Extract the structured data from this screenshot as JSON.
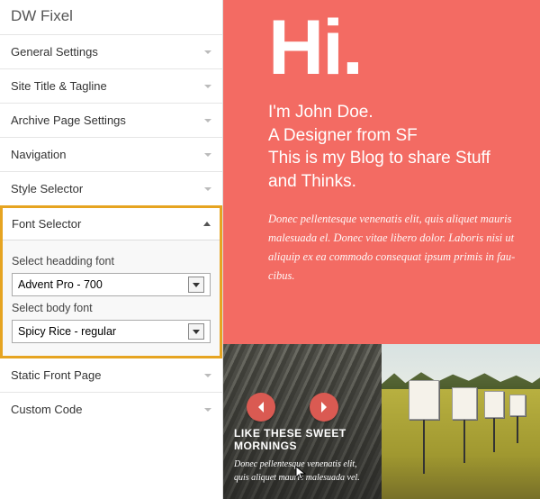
{
  "sidebar": {
    "title": "DW Fixel",
    "items": [
      {
        "label": "General Settings"
      },
      {
        "label": "Site Title & Tagline"
      },
      {
        "label": "Archive Page Settings"
      },
      {
        "label": "Navigation"
      },
      {
        "label": "Style Selector"
      }
    ],
    "font_panel": {
      "title": "Font Selector",
      "heading_label": "Select headding font",
      "heading_value": "Advent Pro - 700",
      "body_label": "Select body font",
      "body_value": "Spicy Rice - regular"
    },
    "items_after": [
      {
        "label": "Static Front Page"
      },
      {
        "label": "Custom Code"
      }
    ]
  },
  "preview": {
    "hero_hi": "Hi.",
    "hero_intro": "I'm John Doe.\nA Designer from SF\nThis is my Blog to share Stuff and Thinks.",
    "hero_body": "Donec pellentesque venenatis elit, quis aliquet mauris malesuada el. Donec vitae libero dolor. Laboris nisi ut aliquip ex ea commodo consequat ipsum primis in fau-cibus.",
    "thumb1": {
      "title": "LIKE THESE SWEET MORNINGS",
      "text": "Donec pellentesque venenatis elit, quis aliquet mauris malesuada vel."
    }
  }
}
